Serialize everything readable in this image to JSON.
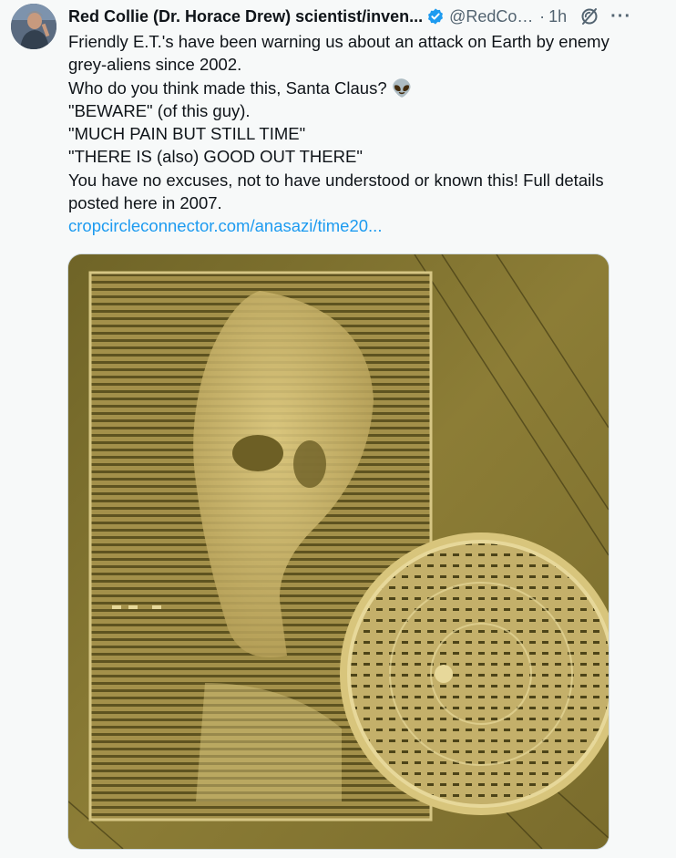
{
  "tweet": {
    "author_name": "Red Collie (Dr. Horace Drew) scientist/inven...",
    "handle": "@RedColli...",
    "separator": "·",
    "time": "1h",
    "more_glyph": "···",
    "text_lines": [
      "Friendly E.T.'s have been warning us about an attack on Earth by enemy",
      "grey-aliens since 2002.",
      "Who do you think made this, Santa Claus? 👽",
      "\"BEWARE\" (of this guy).",
      "\"MUCH PAIN BUT STILL TIME\"",
      "\"THERE IS (also) GOOD OUT THERE\"",
      "You have no excuses, not to have understood or known this! Full details",
      "posted here in 2007."
    ],
    "link_text": "cropcircleconnector.com/anasazi/time20...",
    "icons": {
      "verified": "verified-badge-icon",
      "grok": "grok-icon",
      "more": "more-icon"
    },
    "colors": {
      "link": "#1d9bf0",
      "verified": "#1d9bf0",
      "secondary_text": "#536471"
    }
  }
}
